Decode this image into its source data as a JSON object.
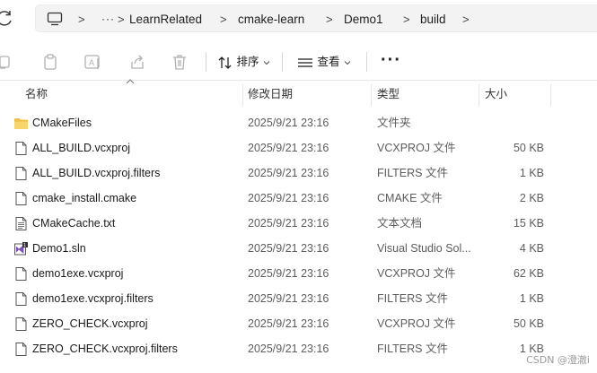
{
  "breadcrumb": {
    "overflow": "···",
    "items": [
      "LearnRelated",
      "cmake-learn",
      "Demo1",
      "build"
    ],
    "separator": ">"
  },
  "toolbar": {
    "sort_label": "排序",
    "view_label": "查看",
    "more_label": "···"
  },
  "columns": {
    "name": "名称",
    "date": "修改日期",
    "type": "类型",
    "size": "大小"
  },
  "files": [
    {
      "name": "CMakeFiles",
      "date": "2025/9/21 23:16",
      "type": "文件夹",
      "size": "",
      "icon": "folder-icon"
    },
    {
      "name": "ALL_BUILD.vcxproj",
      "date": "2025/9/21 23:16",
      "type": "VCXPROJ 文件",
      "size": "50 KB",
      "icon": "file-icon"
    },
    {
      "name": "ALL_BUILD.vcxproj.filters",
      "date": "2025/9/21 23:16",
      "type": "FILTERS 文件",
      "size": "1 KB",
      "icon": "file-icon"
    },
    {
      "name": "cmake_install.cmake",
      "date": "2025/9/21 23:16",
      "type": "CMAKE 文件",
      "size": "2 KB",
      "icon": "file-icon"
    },
    {
      "name": "CMakeCache.txt",
      "date": "2025/9/21 23:16",
      "type": "文本文档",
      "size": "15 KB",
      "icon": "text-file-icon"
    },
    {
      "name": "Demo1.sln",
      "date": "2025/9/21 23:16",
      "type": "Visual Studio Sol...",
      "size": "4 KB",
      "icon": "visual-studio-icon"
    },
    {
      "name": "demo1exe.vcxproj",
      "date": "2025/9/21 23:16",
      "type": "VCXPROJ 文件",
      "size": "62 KB",
      "icon": "file-icon"
    },
    {
      "name": "demo1exe.vcxproj.filters",
      "date": "2025/9/21 23:16",
      "type": "FILTERS 文件",
      "size": "1 KB",
      "icon": "file-icon"
    },
    {
      "name": "ZERO_CHECK.vcxproj",
      "date": "2025/9/21 23:16",
      "type": "VCXPROJ 文件",
      "size": "50 KB",
      "icon": "file-icon"
    },
    {
      "name": "ZERO_CHECK.vcxproj.filters",
      "date": "2025/9/21 23:16",
      "type": "FILTERS 文件",
      "size": "1 KB",
      "icon": "file-icon"
    }
  ],
  "watermark": "CSDN @澄澈i",
  "colors": {
    "folder": "#f0c040",
    "accent": "#0067c0",
    "vs_purple": "#7b4fbf"
  }
}
